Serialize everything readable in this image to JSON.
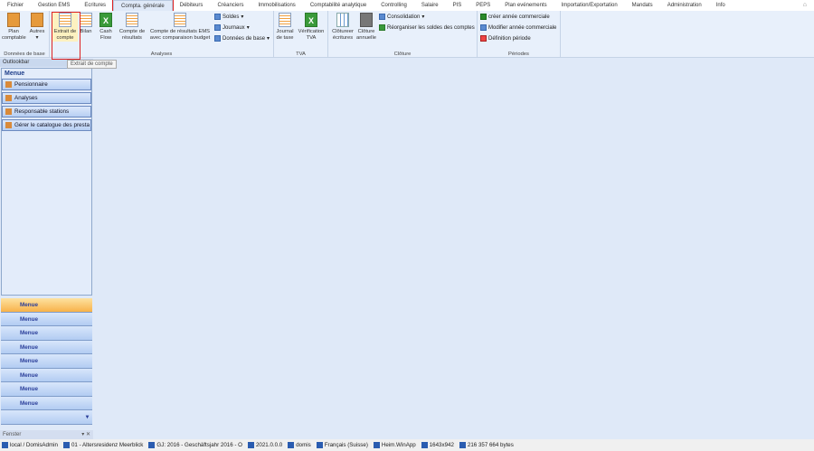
{
  "tabs": [
    "Fichier",
    "Gestion EMS",
    "Ecritures",
    "Compta. générale",
    "Débiteurs",
    "Créanciers",
    "Immobilisations",
    "Comptabilité analytique",
    "Controlling",
    "Salaire",
    "PIS",
    "PEPS",
    "Plan evénements",
    "Importation/Exportation",
    "Mandats",
    "Administration",
    "Info"
  ],
  "ribbon": {
    "donnees": {
      "label": "Données de base",
      "plan": "Plan comptable",
      "autres": "Autres"
    },
    "analyses": {
      "label": "Analyses",
      "extrait": "Extrait de compte",
      "bilan": "Bilan",
      "cash": "Cash Flow",
      "compte_res": "Compte de résultats",
      "compte_ems": "Compte de résultats EMS avec comparaison budget",
      "soldes": "Soldes",
      "journaux": "Journaux",
      "donnees_base": "Données de base"
    },
    "tva": {
      "label": "TVA",
      "journal": "Journal de taxe",
      "verif": "Vérification TVA"
    },
    "cloture": {
      "label": "Clôture",
      "cloturer": "Clôtureer écritures",
      "annuelle": "Clôture annuelle",
      "consolidation": "Consolidation",
      "reorg": "Réorganiser les soldes des comptes"
    },
    "periodes": {
      "label": "Périodes",
      "creer": "créer année commerciale",
      "modifier": "Modifier année commerciale",
      "definition": "Définition période"
    }
  },
  "tooltip": "Extrait de compte",
  "sidebar": {
    "header": "Outlookbar",
    "title": "Menue",
    "items": [
      "Pensionnaire",
      "Analyses",
      "Responsable stations",
      "Gérer le catalogue des presta"
    ],
    "menu_buttons": [
      "Menue",
      "Menue",
      "Menue",
      "Menue",
      "Menue",
      "Menue",
      "Menue",
      "Menue"
    ],
    "fenster": "Fenster"
  },
  "status": [
    "local / DomisAdmin",
    "01 - Altersresidenz Meerblick",
    "GJ: 2016 - Geschäftsjahr 2016 - O",
    "2021.0.0.0",
    "domis",
    "Français (Suisse)",
    "Heim.WinApp",
    "1643x942",
    "216 357 664 bytes"
  ]
}
